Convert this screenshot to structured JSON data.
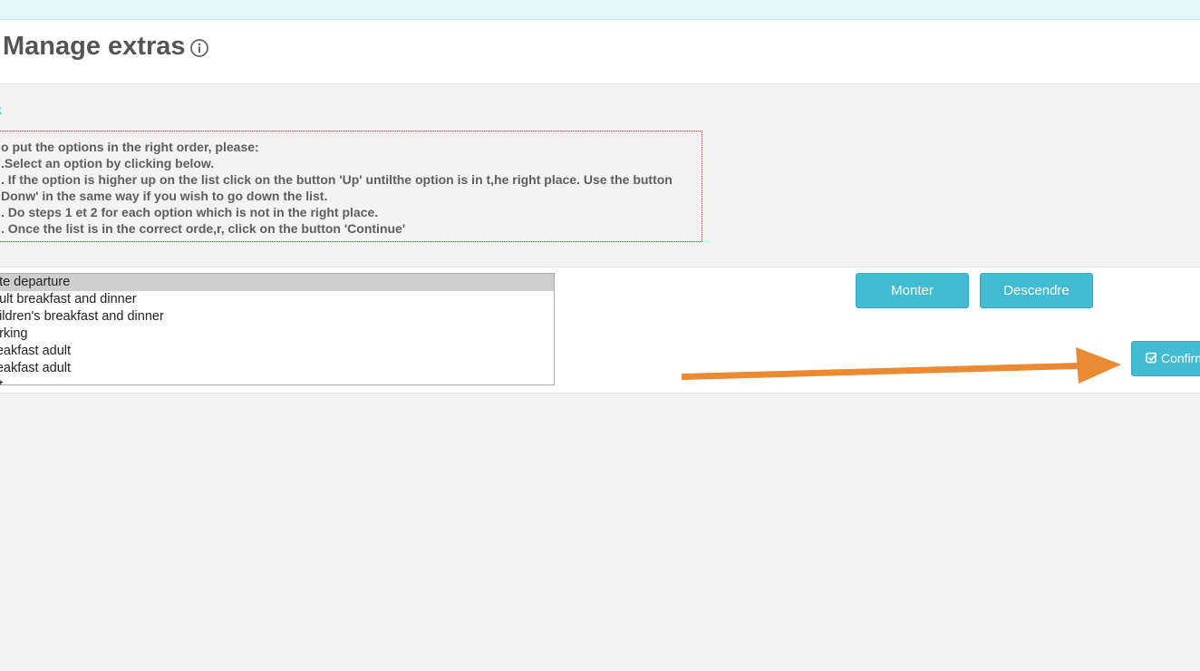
{
  "header": {
    "title": "Manage extras"
  },
  "nav": {
    "back_label": "k"
  },
  "instructions": {
    "lines": [
      "o put the options in the right order, please:",
      ".Select an option by clicking below.",
      ". If the option is higher up on the list click on the button 'Up' untilthe option is in t,he right place. Use the button",
      "Donw' in the same way if you wish to go down the list.",
      ". Do steps 1 et 2 for each option which is not in the right place.",
      ". Once the list is in the correct orde,r, click on the button 'Continue'"
    ]
  },
  "options_list": {
    "items": [
      "ate departure",
      "dult breakfast and dinner",
      "hildren's breakfast and dinner",
      "arking",
      "reakfast adult",
      "reakfast adult",
      "et"
    ],
    "selected_index": 0
  },
  "buttons": {
    "up_label": "Monter",
    "down_label": "Descendre",
    "confirm_label": "Confirm"
  },
  "colors": {
    "accent": "#41bcd2",
    "link": "#27b6cf",
    "annotation_arrow": "#ea8a33",
    "instructions_border": "#c33a3a"
  },
  "icons": {
    "title_info": "info-icon",
    "confirm": "check-square-icon"
  }
}
